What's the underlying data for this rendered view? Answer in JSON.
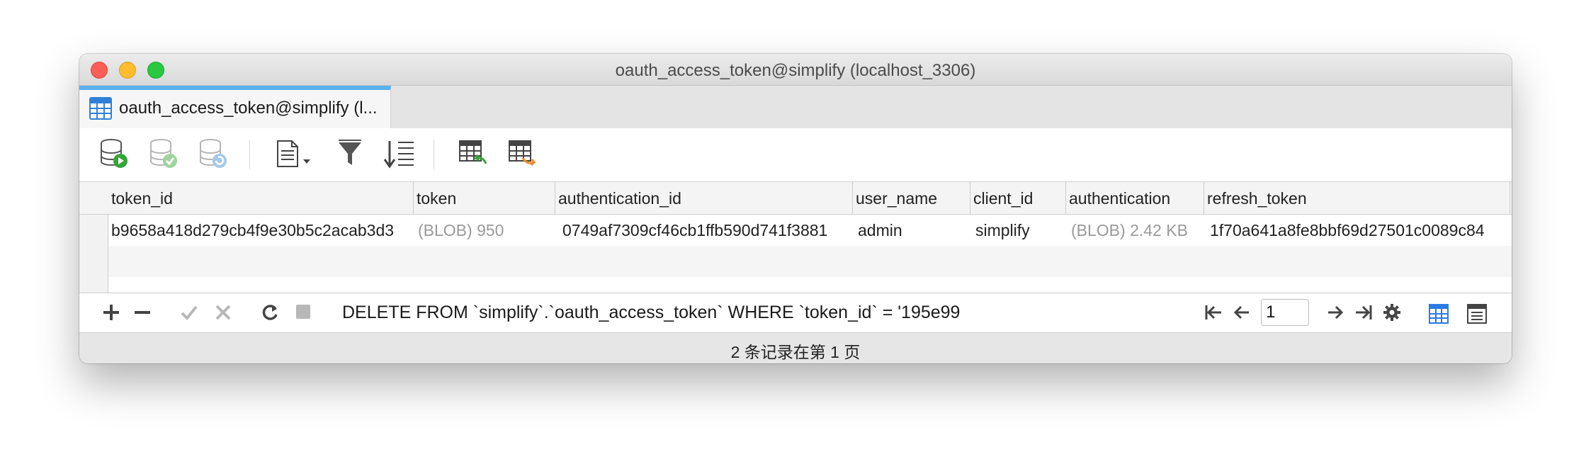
{
  "window": {
    "title": "oauth_access_token@simplify (localhost_3306)"
  },
  "tab": {
    "label": "oauth_access_token@simplify (l..."
  },
  "toolbar": {
    "icons": [
      "db-run-icon",
      "db-apply-icon",
      "db-refresh-icon",
      "document-menu-icon",
      "filter-icon",
      "sort-icon",
      "import-table-icon",
      "export-table-icon"
    ]
  },
  "grid": {
    "columns": [
      "token_id",
      "token",
      "authentication_id",
      "user_name",
      "client_id",
      "authentication",
      "refresh_token"
    ],
    "rows": [
      {
        "token_id": "b9658a418d279cb4f9e30b5c2acab3d3",
        "token": "(BLOB) 950",
        "authentication_id": "0749af7309cf46cb1ffb590d741f3881",
        "user_name": "admin",
        "client_id": "simplify",
        "authentication": "(BLOB) 2.42 KB",
        "refresh_token": "1f70a641a8fe8bbf69d27501c0089c84"
      }
    ]
  },
  "bottombar": {
    "sql": "DELETE FROM `simplify`.`oauth_access_token` WHERE `token_id` = '195e99",
    "page_value": "1"
  },
  "status": {
    "text": "2 条记录在第 1 页"
  },
  "colors": {
    "tab_accent": "#5ab1f0",
    "blob_text": "#9a9a9a",
    "grid_view_active": "#2a7be4"
  }
}
